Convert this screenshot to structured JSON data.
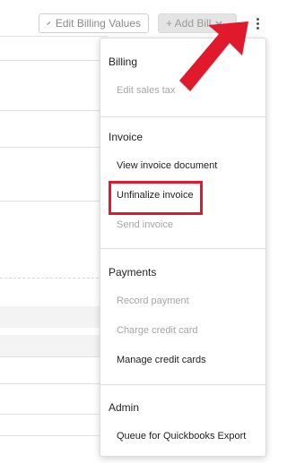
{
  "toolbar": {
    "edit_billing_label": "Edit Billing Values",
    "add_bill_label": "+ Add Bill"
  },
  "menu": {
    "billing": {
      "heading": "Billing",
      "items": [
        "Edit sales tax"
      ]
    },
    "invoice": {
      "heading": "Invoice",
      "items": [
        "View invoice document",
        "Unfinalize invoice",
        "Send invoice"
      ]
    },
    "payments": {
      "heading": "Payments",
      "items": [
        "Record payment",
        "Charge credit card",
        "Manage credit cards"
      ]
    },
    "admin": {
      "heading": "Admin",
      "items": [
        "Queue for Quickbooks Export"
      ]
    }
  },
  "colors": {
    "highlight": "#e0192c",
    "arrow": "#e0192c",
    "disabled_text": "#a6a6a6"
  },
  "icons": [
    "pencil-icon",
    "chevron-down-icon",
    "kebab-menu-icon",
    "red-arrow-annotation"
  ]
}
